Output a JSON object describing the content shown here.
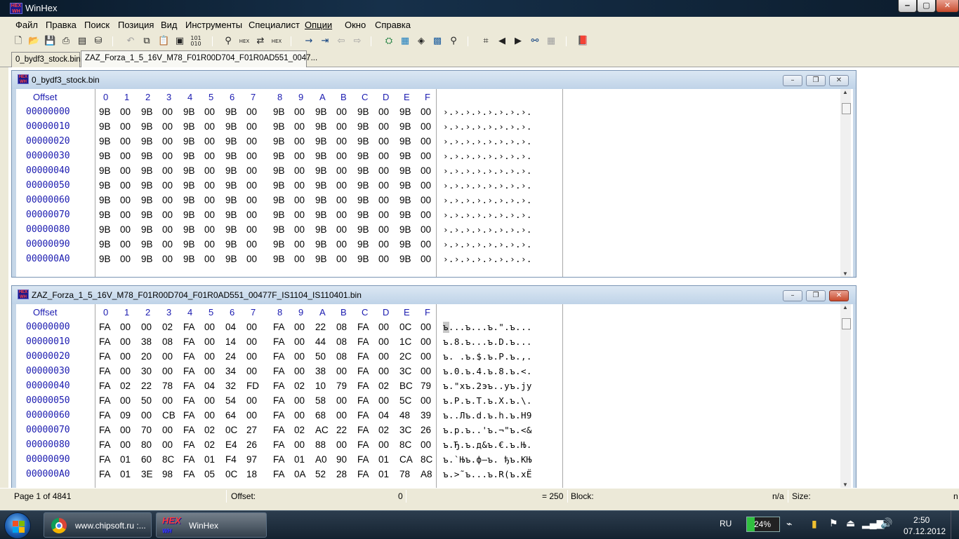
{
  "app": {
    "title": "WinHex"
  },
  "menu": [
    "Файл",
    "Правка",
    "Поиск",
    "Позиция",
    "Вид",
    "Инструменты",
    "Специалист",
    "Опции",
    "Окно",
    "Справка"
  ],
  "toolbar_icons": [
    "new-icon",
    "open-icon",
    "save-icon",
    "print-icon",
    "properties-icon",
    "open-disk-icon",
    "undo-icon",
    "copy-icon",
    "paste-icon",
    "clipboard-icon",
    "convert-icon",
    "find-text-icon",
    "find-hex-icon",
    "replace-text-icon",
    "replace-hex-icon",
    "goto-offset-icon",
    "goto-sector-icon",
    "back-icon",
    "forward-icon",
    "disk-editor-icon",
    "ram-editor-icon",
    "data-interpreter-icon",
    "calculator-icon",
    "analyze-icon",
    "hash-icon",
    "previous-icon",
    "next-icon",
    "search-binoculars-icon",
    "table-icon",
    "book-icon"
  ],
  "tabs": [
    "0_bydf3_stock.bin",
    "ZAZ_Forza_1_5_16V_M78_F01R00D704_F01R0AD551_0047..."
  ],
  "header": {
    "offset_label": "Offset",
    "columns": [
      "0",
      "1",
      "2",
      "3",
      "4",
      "5",
      "6",
      "7",
      "8",
      "9",
      "A",
      "B",
      "C",
      "D",
      "E",
      "F"
    ]
  },
  "windows": [
    {
      "title": "0_bydf3_stock.bin",
      "rows": [
        {
          "offset": "00000000",
          "bytes": [
            "9B",
            "00",
            "9B",
            "00",
            "9B",
            "00",
            "9B",
            "00",
            "9B",
            "00",
            "9B",
            "00",
            "9B",
            "00",
            "9B",
            "00"
          ],
          "ascii": "›.›.›.›.›.›.›.›."
        },
        {
          "offset": "00000010",
          "bytes": [
            "9B",
            "00",
            "9B",
            "00",
            "9B",
            "00",
            "9B",
            "00",
            "9B",
            "00",
            "9B",
            "00",
            "9B",
            "00",
            "9B",
            "00"
          ],
          "ascii": "›.›.›.›.›.›.›.›."
        },
        {
          "offset": "00000020",
          "bytes": [
            "9B",
            "00",
            "9B",
            "00",
            "9B",
            "00",
            "9B",
            "00",
            "9B",
            "00",
            "9B",
            "00",
            "9B",
            "00",
            "9B",
            "00"
          ],
          "ascii": "›.›.›.›.›.›.›.›."
        },
        {
          "offset": "00000030",
          "bytes": [
            "9B",
            "00",
            "9B",
            "00",
            "9B",
            "00",
            "9B",
            "00",
            "9B",
            "00",
            "9B",
            "00",
            "9B",
            "00",
            "9B",
            "00"
          ],
          "ascii": "›.›.›.›.›.›.›.›."
        },
        {
          "offset": "00000040",
          "bytes": [
            "9B",
            "00",
            "9B",
            "00",
            "9B",
            "00",
            "9B",
            "00",
            "9B",
            "00",
            "9B",
            "00",
            "9B",
            "00",
            "9B",
            "00"
          ],
          "ascii": "›.›.›.›.›.›.›.›."
        },
        {
          "offset": "00000050",
          "bytes": [
            "9B",
            "00",
            "9B",
            "00",
            "9B",
            "00",
            "9B",
            "00",
            "9B",
            "00",
            "9B",
            "00",
            "9B",
            "00",
            "9B",
            "00"
          ],
          "ascii": "›.›.›.›.›.›.›.›."
        },
        {
          "offset": "00000060",
          "bytes": [
            "9B",
            "00",
            "9B",
            "00",
            "9B",
            "00",
            "9B",
            "00",
            "9B",
            "00",
            "9B",
            "00",
            "9B",
            "00",
            "9B",
            "00"
          ],
          "ascii": "›.›.›.›.›.›.›.›."
        },
        {
          "offset": "00000070",
          "bytes": [
            "9B",
            "00",
            "9B",
            "00",
            "9B",
            "00",
            "9B",
            "00",
            "9B",
            "00",
            "9B",
            "00",
            "9B",
            "00",
            "9B",
            "00"
          ],
          "ascii": "›.›.›.›.›.›.›.›."
        },
        {
          "offset": "00000080",
          "bytes": [
            "9B",
            "00",
            "9B",
            "00",
            "9B",
            "00",
            "9B",
            "00",
            "9B",
            "00",
            "9B",
            "00",
            "9B",
            "00",
            "9B",
            "00"
          ],
          "ascii": "›.›.›.›.›.›.›.›."
        },
        {
          "offset": "00000090",
          "bytes": [
            "9B",
            "00",
            "9B",
            "00",
            "9B",
            "00",
            "9B",
            "00",
            "9B",
            "00",
            "9B",
            "00",
            "9B",
            "00",
            "9B",
            "00"
          ],
          "ascii": "›.›.›.›.›.›.›.›."
        },
        {
          "offset": "000000A0",
          "bytes": [
            "9B",
            "00",
            "9B",
            "00",
            "9B",
            "00",
            "9B",
            "00",
            "9B",
            "00",
            "9B",
            "00",
            "9B",
            "00",
            "9B",
            "00"
          ],
          "ascii": "›.›.›.›.›.›.›.›."
        }
      ]
    },
    {
      "title": "ZAZ_Forza_1_5_16V_M78_F01R00D704_F01R0AD551_00477F_IS1104_IS110401.bin",
      "rows": [
        {
          "offset": "00000000",
          "bytes": [
            "FA",
            "00",
            "00",
            "02",
            "FA",
            "00",
            "04",
            "00",
            "FA",
            "00",
            "22",
            "08",
            "FA",
            "00",
            "0C",
            "00"
          ],
          "ascii": "ъ...ъ...ъ.\".ъ..."
        },
        {
          "offset": "00000010",
          "bytes": [
            "FA",
            "00",
            "38",
            "08",
            "FA",
            "00",
            "14",
            "00",
            "FA",
            "00",
            "44",
            "08",
            "FA",
            "00",
            "1C",
            "00"
          ],
          "ascii": "ъ.8.ъ...ъ.D.ъ..."
        },
        {
          "offset": "00000020",
          "bytes": [
            "FA",
            "00",
            "20",
            "00",
            "FA",
            "00",
            "24",
            "00",
            "FA",
            "00",
            "50",
            "08",
            "FA",
            "00",
            "2C",
            "00"
          ],
          "ascii": "ъ. .ъ.$.ъ.P.ъ.,."
        },
        {
          "offset": "00000030",
          "bytes": [
            "FA",
            "00",
            "30",
            "00",
            "FA",
            "00",
            "34",
            "00",
            "FA",
            "00",
            "38",
            "00",
            "FA",
            "00",
            "3C",
            "00"
          ],
          "ascii": "ъ.0.ъ.4.ъ.8.ъ.<."
        },
        {
          "offset": "00000040",
          "bytes": [
            "FA",
            "02",
            "22",
            "78",
            "FA",
            "04",
            "32",
            "FD",
            "FA",
            "02",
            "10",
            "79",
            "FA",
            "02",
            "BC",
            "79"
          ],
          "ascii": "ъ.\"xъ.2эъ..yъ.јy"
        },
        {
          "offset": "00000050",
          "bytes": [
            "FA",
            "00",
            "50",
            "00",
            "FA",
            "00",
            "54",
            "00",
            "FA",
            "00",
            "58",
            "00",
            "FA",
            "00",
            "5C",
            "00"
          ],
          "ascii": "ъ.P.ъ.T.ъ.X.ъ.\\."
        },
        {
          "offset": "00000060",
          "bytes": [
            "FA",
            "09",
            "00",
            "CB",
            "FA",
            "00",
            "64",
            "00",
            "FA",
            "00",
            "68",
            "00",
            "FA",
            "04",
            "48",
            "39"
          ],
          "ascii": "ъ..Лъ.d.ъ.h.ъ.H9"
        },
        {
          "offset": "00000070",
          "bytes": [
            "FA",
            "00",
            "70",
            "00",
            "FA",
            "02",
            "0C",
            "27",
            "FA",
            "02",
            "AC",
            "22",
            "FA",
            "02",
            "3C",
            "26"
          ],
          "ascii": "ъ.p.ъ..'ъ.¬\"ъ.<&"
        },
        {
          "offset": "00000080",
          "bytes": [
            "FA",
            "00",
            "80",
            "00",
            "FA",
            "02",
            "E4",
            "26",
            "FA",
            "00",
            "88",
            "00",
            "FA",
            "00",
            "8C",
            "00"
          ],
          "ascii": "ъ.Ђ.ъ.д&ъ.€.ъ.Њ."
        },
        {
          "offset": "00000090",
          "bytes": [
            "FA",
            "01",
            "60",
            "8C",
            "FA",
            "01",
            "F4",
            "97",
            "FA",
            "01",
            "A0",
            "90",
            "FA",
            "01",
            "CA",
            "8C"
          ],
          "ascii": "ъ.`Њъ.ф—ъ. ђъ.КЊ"
        },
        {
          "offset": "000000A0",
          "bytes": [
            "FA",
            "01",
            "3E",
            "98",
            "FA",
            "05",
            "0C",
            "18",
            "FA",
            "0A",
            "52",
            "28",
            "FA",
            "01",
            "78",
            "A8"
          ],
          "ascii": "ъ.>˜ъ...ъ.R(ъ.xЁ"
        }
      ]
    }
  ],
  "status": {
    "page": "Page 1 of 4841",
    "offset_label": "Offset:",
    "offset_value": "0",
    "value": "= 250",
    "block_label": "Block:",
    "block_value": "n/a",
    "size_label": "Size:",
    "size_value": "n"
  },
  "taskbar": {
    "tasks": [
      {
        "label": "www.chipsoft.ru :..."
      },
      {
        "label": "WinHex"
      }
    ],
    "language": "RU",
    "battery": "24%",
    "time": "2:50",
    "date": "07.12.2012"
  },
  "colors": {
    "offset_text": "#1b1bb0",
    "window_frame": "#c6d7e8",
    "close_red": "#c84a2c"
  }
}
